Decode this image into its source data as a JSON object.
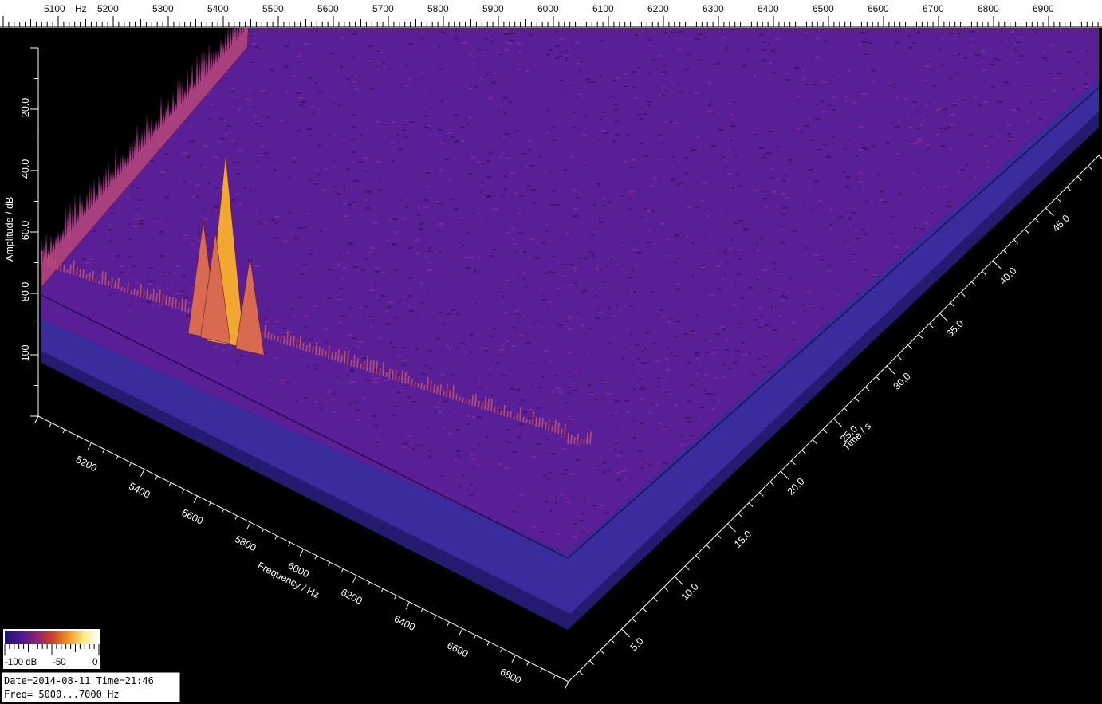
{
  "top_ruler": {
    "labels": [
      "5100",
      "Hz",
      "5200",
      "5300",
      "5400",
      "5500",
      "5600",
      "5700",
      "5800",
      "5900",
      "6000",
      "6100",
      "6200",
      "6300",
      "6400",
      "6500",
      "6600",
      "6700",
      "6800",
      "6900"
    ]
  },
  "axes": {
    "amplitude_label": "Amplitude / dB",
    "amplitude_ticks": [
      "-20.0",
      "-40.0",
      "-60.0",
      "-80.0",
      "-100"
    ],
    "frequency_label": "Frequency / Hz",
    "frequency_ticks": [
      "5200",
      "5400",
      "5600",
      "5800",
      "6000",
      "6200",
      "6400",
      "6600",
      "6800"
    ],
    "time_label": "Time / s",
    "time_ticks": [
      "5.0",
      "10.0",
      "15.0",
      "20.0",
      "25.0",
      "30.0",
      "35.0",
      "40.0",
      "45.0"
    ]
  },
  "legend": {
    "labels": [
      "-100 dB",
      "-50",
      "0"
    ],
    "colors": [
      "#1a1470",
      "#4a1890",
      "#8a2078",
      "#c8402a",
      "#f09020",
      "#ffe880",
      "#ffffff"
    ]
  },
  "info": {
    "line1": "Date=2014-08-11 Time=21:46",
    "line2": "Freq= 5000...7000 Hz"
  },
  "colors": {
    "background": "#000000",
    "floor": "#5a2098",
    "floor_noise": "#7a2890",
    "base": "#3c2a9a",
    "peak": "#f0a030",
    "ruler": "#ffffff"
  },
  "chart_data": {
    "type": "surface-3d",
    "x": {
      "label": "Frequency / Hz",
      "range": [
        5000,
        7000
      ]
    },
    "y": {
      "label": "Time / s",
      "range": [
        0,
        50
      ]
    },
    "z": {
      "label": "Amplitude / dB",
      "range": [
        -120,
        0
      ]
    },
    "color_scale": {
      "min": -100,
      "max": 0,
      "unit": "dB"
    },
    "noise_floor_db": -80,
    "peaks": [
      {
        "frequency": 5750,
        "time": 1,
        "amplitude": -57
      },
      {
        "frequency": 5640,
        "time": 1,
        "amplitude": -78
      },
      {
        "frequency": 5700,
        "time": 1,
        "amplitude": -80
      },
      {
        "frequency": 5870,
        "time": 1,
        "amplitude": -84
      }
    ]
  }
}
